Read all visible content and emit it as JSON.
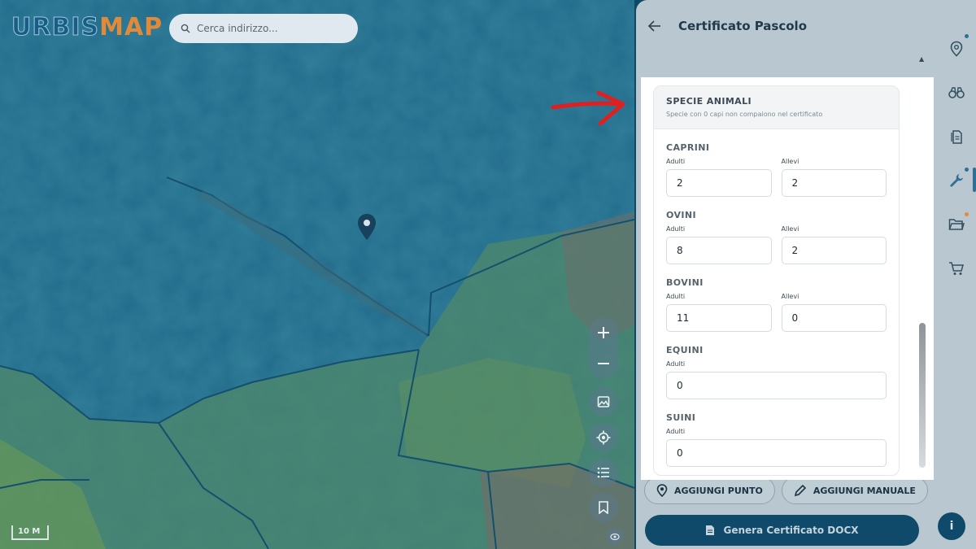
{
  "app": {
    "logo_part1": "URBIS",
    "logo_part2": "MAP"
  },
  "search": {
    "placeholder": "Cerca indirizzo..."
  },
  "map": {
    "scale_label": "10 M",
    "controls": [
      "zoom-in",
      "zoom-out",
      "image-icon",
      "locate-icon",
      "list-icon",
      "bookmark-icon"
    ]
  },
  "panel": {
    "title": "Certificato Pascolo",
    "card": {
      "title": "SPECIE ANIMALI",
      "subtitle": "Specie con 0 capi non compaiono nel certificato",
      "species": [
        {
          "name": "CAPRINI",
          "adulti_label": "Adulti",
          "adulti": "2",
          "allevi_label": "Allevi",
          "allevi": "2"
        },
        {
          "name": "OVINI",
          "adulti_label": "Adulti",
          "adulti": "8",
          "allevi_label": "Allevi",
          "allevi": "2"
        },
        {
          "name": "BOVINI",
          "adulti_label": "Adulti",
          "adulti": "11",
          "allevi_label": "Allevi",
          "allevi": "0"
        },
        {
          "name": "EQUINI",
          "adulti_label": "Adulti",
          "adulti": "0"
        },
        {
          "name": "SUINI",
          "adulti_label": "Adulti",
          "adulti": "0"
        }
      ]
    },
    "buttons": {
      "add_point": "AGGIUNGI PUNTO",
      "add_manual": "AGGIUNGI MANUALE",
      "generate": "Genera Certificato DOCX"
    }
  },
  "sidebar": {
    "items": [
      "location-pin-icon",
      "binoculars-icon",
      "documents-icon",
      "wrench-icon",
      "folder-icon",
      "cart-icon"
    ],
    "info_label": "i"
  },
  "colors": {
    "accent": "#0f4a6a",
    "arrow": "#e02020",
    "dot_blue": "#2f6f95",
    "dot_orange": "#e08a3a"
  }
}
